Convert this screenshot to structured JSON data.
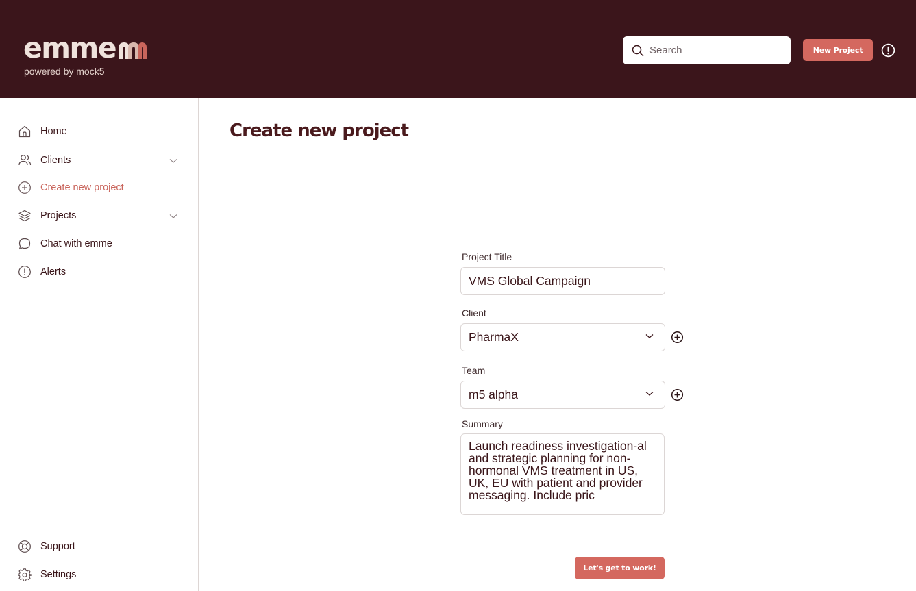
{
  "header": {
    "logo_text": "emme",
    "logo_subtitle": "powered by mock5",
    "search_placeholder": "Search",
    "new_project_label": "New Project",
    "bg_color": "#3b151b",
    "accent_color": "#d4685f"
  },
  "sidebar": {
    "items": [
      {
        "label": "Home",
        "icon": "home-icon"
      },
      {
        "label": "Clients",
        "icon": "users-icon",
        "expandable": true
      },
      {
        "label": "Create new project",
        "icon": "plus-circle-icon",
        "active": true
      },
      {
        "label": "Projects",
        "icon": "layers-icon",
        "expandable": true
      },
      {
        "label": "Chat with emme",
        "icon": "chat-icon"
      },
      {
        "label": "Alerts",
        "icon": "alert-circle-icon"
      }
    ],
    "footer": [
      {
        "label": "Support",
        "icon": "lifebuoy-icon"
      },
      {
        "label": "Settings",
        "icon": "gear-icon"
      }
    ]
  },
  "main": {
    "page_title": "Create new project",
    "form": {
      "title_label": "Project Title",
      "title_value": "VMS Global Campaign",
      "client_label": "Client",
      "client_value": "PharmaX",
      "team_label": "Team",
      "team_value": "m5 alpha",
      "summary_label": "Summary",
      "summary_value": "Launch readiness investigation-al and strategic planning for non-hormonal VMS treatment in US, UK, EU with patient and provider messaging. Include pric",
      "submit_label": "Let's get to work!"
    }
  }
}
